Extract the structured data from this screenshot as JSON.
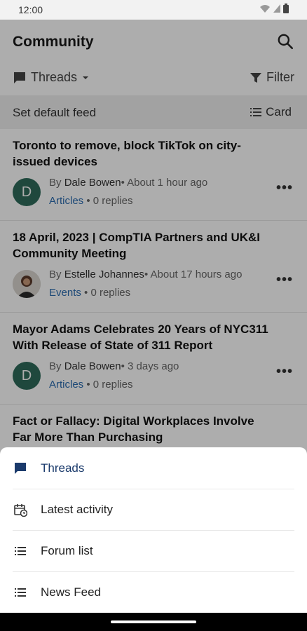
{
  "status": {
    "time": "12:00"
  },
  "app": {
    "title": "Community"
  },
  "toolbar": {
    "view_label": "Threads",
    "filter_label": "Filter"
  },
  "feedbar": {
    "default_label": "Set default feed",
    "card_label": "Card"
  },
  "posts": [
    {
      "title": "Toronto to remove, block TikTok on city-issued devices",
      "by": "By",
      "author": "Dale Bowen",
      "time": "• About 1 hour ago",
      "category": "Articles",
      "replies": " • 0 replies",
      "avatar_letter": "D"
    },
    {
      "title": "18 April, 2023 | CompTIA Partners and UK&I Community Meeting",
      "by": "By",
      "author": "Estelle Johannes",
      "time": "• About 17 hours ago",
      "category": "Events",
      "replies": " • 0 replies",
      "avatar_letter": ""
    },
    {
      "title": "Mayor Adams Celebrates 20 Years of NYC311 With Release of State of 311 Report",
      "by": "By",
      "author": "Dale Bowen",
      "time": "• 3 days ago",
      "category": "Articles",
      "replies": " • 0 replies",
      "avatar_letter": "D"
    },
    {
      "title": "Fact or Fallacy: Digital Workplaces Involve Far More Than Purchasing",
      "by": "",
      "author": "",
      "time": "",
      "category": "",
      "replies": "",
      "avatar_letter": ""
    }
  ],
  "sheet": {
    "items": [
      {
        "label": "Threads",
        "icon": "chat-bubble-icon",
        "active": true
      },
      {
        "label": "Latest activity",
        "icon": "calendar-clock-icon",
        "active": false
      },
      {
        "label": "Forum list",
        "icon": "list-icon",
        "active": false
      },
      {
        "label": "News Feed",
        "icon": "list-icon",
        "active": false
      }
    ]
  },
  "colors": {
    "accent": "#1a3a6b",
    "avatar": "#2e6b5a",
    "link": "#2b6cb0"
  }
}
